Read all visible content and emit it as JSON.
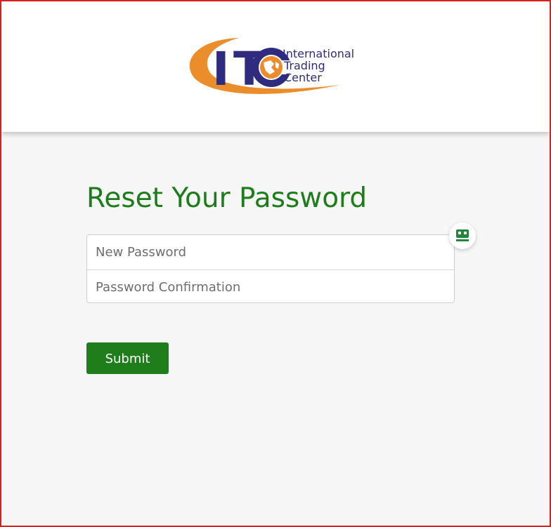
{
  "brand": {
    "mark": "ITC",
    "name_lines": [
      "International",
      "Trading",
      "Center"
    ]
  },
  "page": {
    "title": "Reset Your Password"
  },
  "form": {
    "new_password_placeholder": "New Password",
    "password_confirmation_placeholder": "Password Confirmation",
    "submit_label": "Submit"
  },
  "colors": {
    "accent_green": "#1f7e1b",
    "title_green": "#1d7d1a",
    "logo_blue": "#2f2b7e",
    "logo_orange": "#ec8d2c",
    "page_background": "#f6f6f6",
    "frame_border": "#d9201f"
  },
  "icons": {
    "field_helper": "password-manager-icon"
  }
}
